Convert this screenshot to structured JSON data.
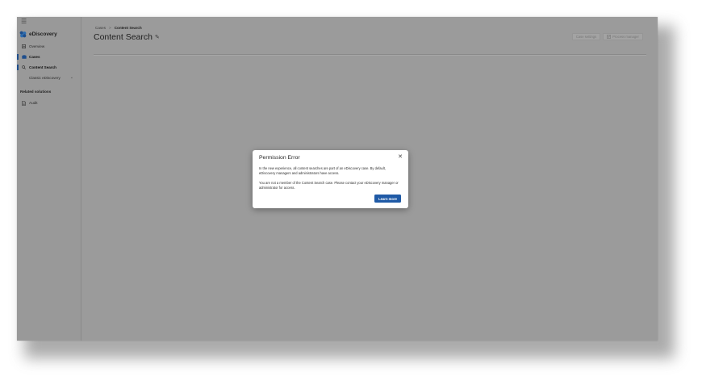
{
  "app": {
    "name": "eDiscovery",
    "menu_icon": "hamburger-icon",
    "logo_icon": "ediscovery-logo-icon"
  },
  "sidebar": {
    "items": [
      {
        "label": "Overview",
        "icon": "overview-icon",
        "active": false
      },
      {
        "label": "Cases",
        "icon": "cases-icon",
        "active": true
      },
      {
        "label": "Content Search",
        "icon": "search-icon",
        "active": true
      },
      {
        "label": "Classic eDiscovery",
        "icon": "chevron-down-icon",
        "active": false
      }
    ],
    "related_title": "Related solutions",
    "related_items": [
      {
        "label": "Audit",
        "icon": "audit-icon"
      }
    ]
  },
  "breadcrumb": {
    "parent": "Cases",
    "separator": ">",
    "current": "Content Search"
  },
  "page": {
    "title": "Content Search",
    "edit_icon": "pencil-icon"
  },
  "toolbar": {
    "case_settings_label": "Case settings",
    "process_manager_label": "Process manager",
    "process_manager_icon": "process-icon"
  },
  "dialog": {
    "title": "Permission Error",
    "close_icon": "close-icon",
    "paragraph1": "In the new experience, all content searches are part of an eDiscovery case. By default, eDiscovery managers and administrators have access.",
    "paragraph2": "You are not a member of the Content Search case. Please contact your eDiscovery manager or administrator for access.",
    "button_label": "Learn more"
  },
  "colors": {
    "accent": "#1f5aa6",
    "overlay": "#9b9b9b",
    "active_indicator": "#1e4e8c"
  }
}
